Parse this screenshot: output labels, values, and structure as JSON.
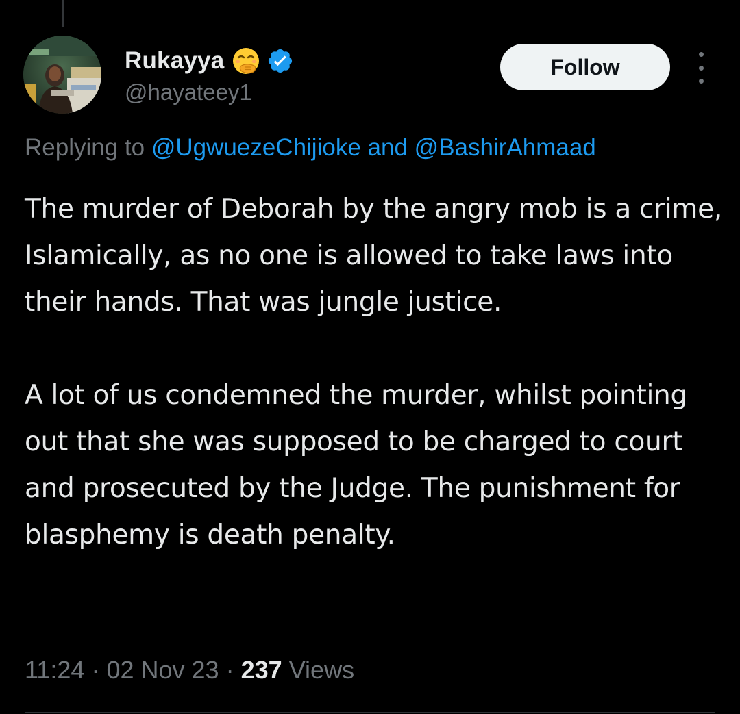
{
  "tweet": {
    "author": {
      "display_name": "Rukayya",
      "emoji": "face-with-hand-over-mouth",
      "verified": true,
      "handle": "@hayateey1"
    },
    "follow_label": "Follow",
    "replying_to": {
      "prefix": "Replying to",
      "mention_1": "@UgwuezeChijioke",
      "joiner": "and",
      "mention_2": "@BashirAhmaad"
    },
    "body": {
      "paragraph_1": "The murder of Deborah by the angry mob is a crime, Islamically, as no one is allowed to take laws into their hands. That was jungle justice.",
      "paragraph_2": "A lot of us condemned the murder, whilst pointing out that she was supposed to be charged to court and prosecuted by the Judge. The punishment for blasphemy is death penalty."
    },
    "meta": {
      "time": "11:24",
      "separator": "·",
      "date": "02 Nov 23",
      "views_count": "237",
      "views_label": "Views"
    }
  },
  "colors": {
    "background": "#000000",
    "text_primary": "#e7e9ea",
    "text_secondary": "#71767b",
    "link_blue": "#1d9bf0",
    "follow_button_bg": "#eff3f4"
  },
  "icons": [
    "avatar",
    "face-with-hand-over-mouth-icon",
    "verified-badge-icon",
    "more-options-icon"
  ]
}
